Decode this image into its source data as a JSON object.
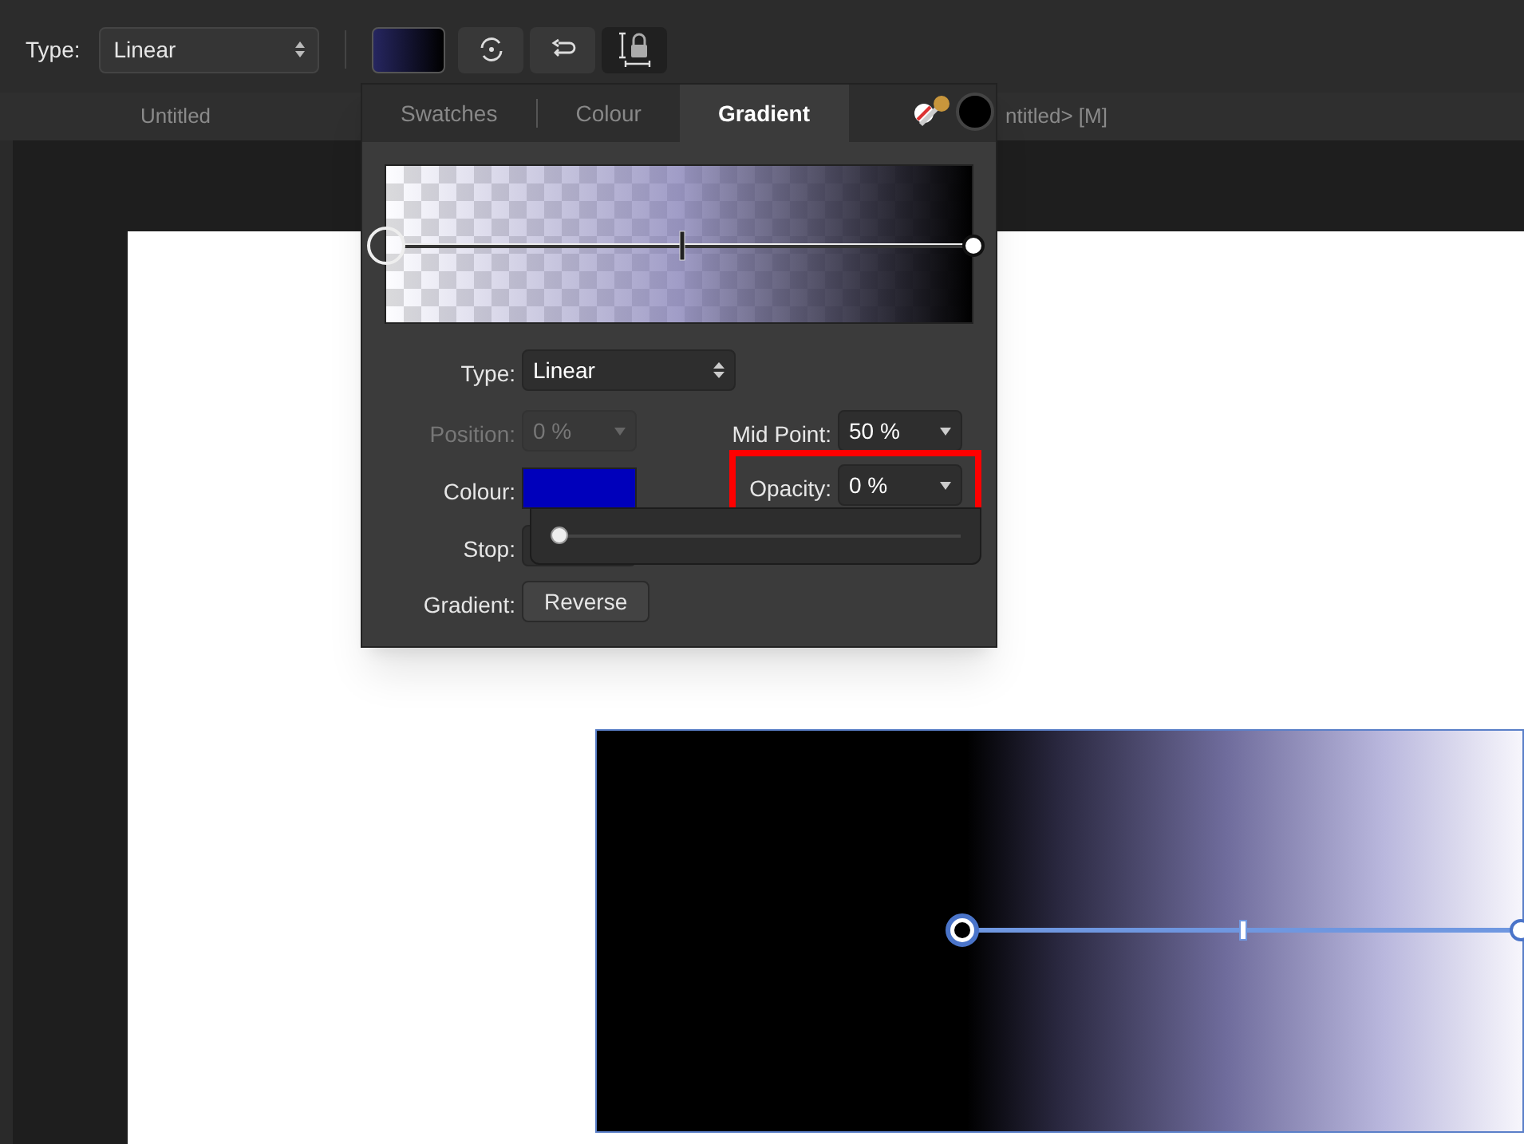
{
  "toolbar": {
    "type_label": "Type:",
    "type_value": "Linear"
  },
  "document_tabs": [
    "Untitled",
    "ntitled> [M]"
  ],
  "panel": {
    "tabs": [
      {
        "label": "Swatches",
        "selected": false
      },
      {
        "label": "Colour",
        "selected": false
      },
      {
        "label": "Gradient",
        "selected": true
      }
    ],
    "fields": [
      {
        "label": "Type:",
        "value": "Linear",
        "disabled": false
      },
      {
        "label": "Position:",
        "value": "0 %",
        "disabled": true
      },
      {
        "label": "Mid Point:",
        "value": "50 %",
        "disabled": false
      },
      {
        "label": "Colour:"
      },
      {
        "label": "Opacity:",
        "value": "0 %",
        "disabled": false
      },
      {
        "label": "Stop:"
      },
      {
        "label": "Gradient:",
        "button": "Reverse"
      }
    ],
    "opacity_slider": {
      "level": 0
    }
  }
}
